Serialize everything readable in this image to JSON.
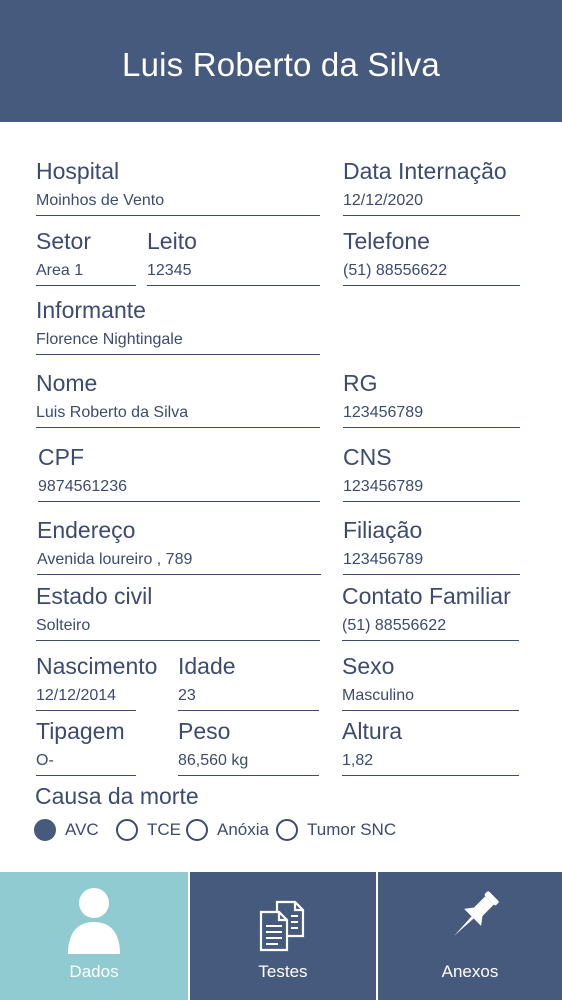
{
  "header": {
    "title": "Luis Roberto da Silva"
  },
  "fields": {
    "hospital": {
      "label": "Hospital",
      "value": "Moinhos de Vento"
    },
    "data_internacao": {
      "label": "Data Internação",
      "value": "12/12/2020"
    },
    "setor": {
      "label": "Setor",
      "value": "Area 1"
    },
    "leito": {
      "label": "Leito",
      "value": "12345"
    },
    "telefone": {
      "label": "Telefone",
      "value": "(51) 88556622"
    },
    "informante": {
      "label": "Informante",
      "value": "Florence Nightingale"
    },
    "nome": {
      "label": "Nome",
      "value": "Luis Roberto da Silva"
    },
    "rg": {
      "label": "RG",
      "value": "123456789"
    },
    "cpf": {
      "label": "CPF",
      "value": "9874561236"
    },
    "cns": {
      "label": "CNS",
      "value": "123456789"
    },
    "endereco": {
      "label": "Endereço",
      "value": "Avenida loureiro , 789"
    },
    "filiacao": {
      "label": "Filiação",
      "value": "123456789"
    },
    "estado_civil": {
      "label": "Estado civil",
      "value": "Solteiro"
    },
    "contato_familiar": {
      "label": "Contato Familiar",
      "value": "(51) 88556622"
    },
    "nascimento": {
      "label": "Nascimento",
      "value": "12/12/2014"
    },
    "idade": {
      "label": "Idade",
      "value": "23"
    },
    "sexo": {
      "label": "Sexo",
      "value": "Masculino"
    },
    "tipagem": {
      "label": "Tipagem",
      "value": "O-"
    },
    "peso": {
      "label": "Peso",
      "value": "86,560 kg"
    },
    "altura": {
      "label": "Altura",
      "value": "1,82"
    }
  },
  "causa_da_morte": {
    "label": "Causa da morte",
    "options": [
      "AVC",
      "TCE",
      "Anóxia",
      "Tumor SNC"
    ],
    "selected": "AVC"
  },
  "tabs": [
    {
      "label": "Dados",
      "icon": "person-icon",
      "active": true
    },
    {
      "label": "Testes",
      "icon": "documents-icon",
      "active": false
    },
    {
      "label": "Anexos",
      "icon": "pushpin-icon",
      "active": false
    }
  ],
  "colors": {
    "header": "#465a7e",
    "text": "#3c4b6e",
    "tab": "#465a7e",
    "tab_active": "#8fcbd1"
  }
}
